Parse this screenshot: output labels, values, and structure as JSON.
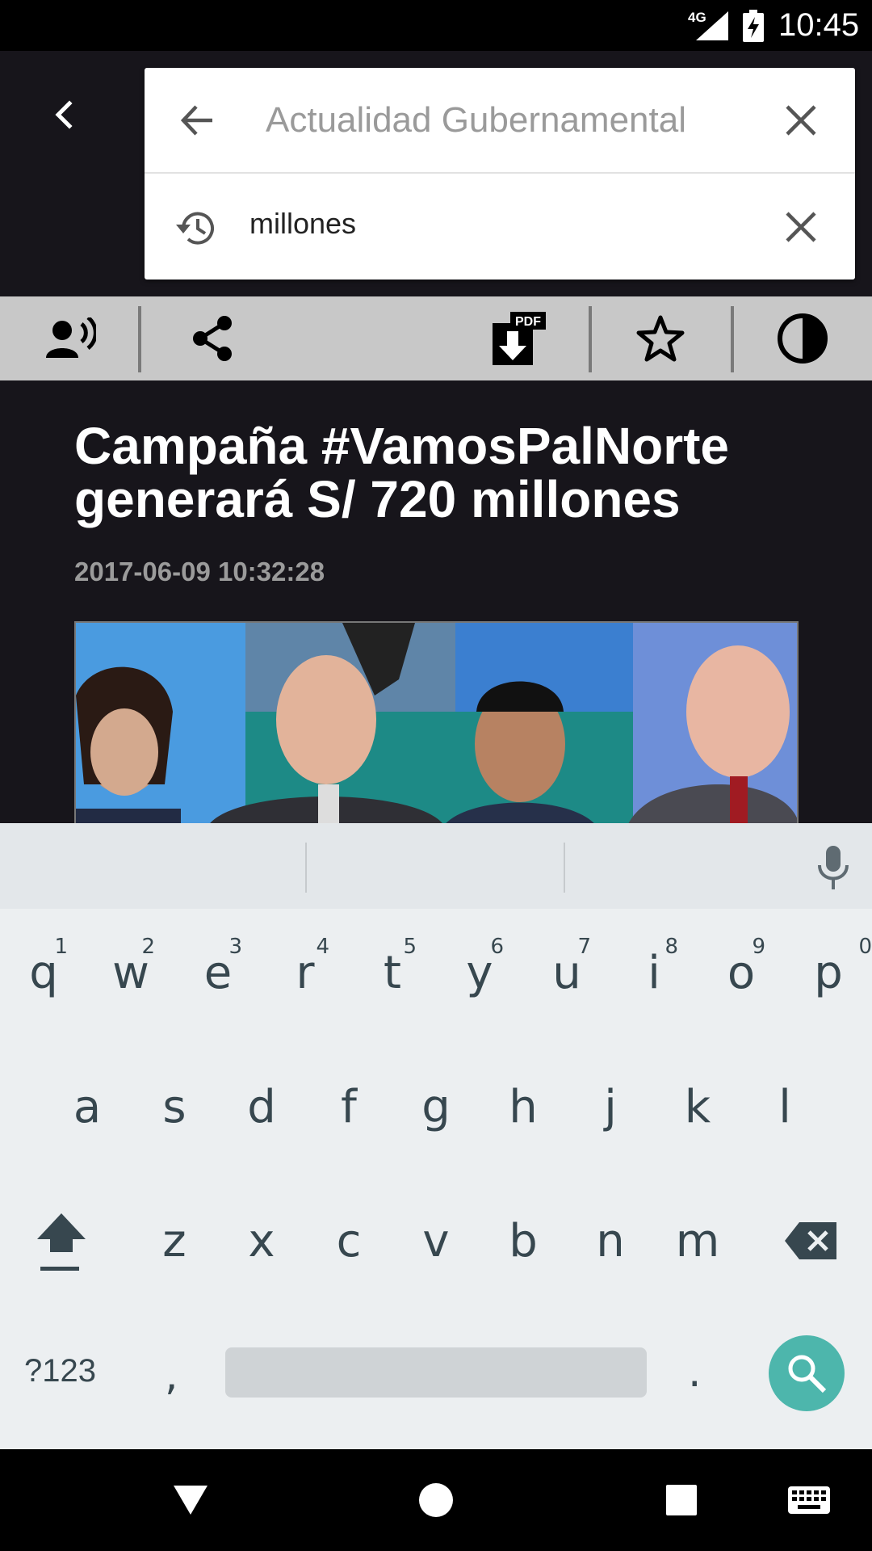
{
  "status_bar": {
    "network": "4G",
    "time": "10:45"
  },
  "search": {
    "placeholder": "Actualidad Gubernamental",
    "value": "",
    "suggestions": [
      {
        "text": "millones"
      }
    ]
  },
  "toolbar": {
    "items": [
      "voice-read",
      "share",
      "download-pdf",
      "favorite",
      "contrast"
    ],
    "pdf_badge": "PDF"
  },
  "article": {
    "title": "Campaña #VamosPalNorte generará S/ 720 millones",
    "date": "2017-06-09 10:32:28"
  },
  "keyboard": {
    "row1": [
      {
        "key": "q",
        "hint": "1"
      },
      {
        "key": "w",
        "hint": "2"
      },
      {
        "key": "e",
        "hint": "3"
      },
      {
        "key": "r",
        "hint": "4"
      },
      {
        "key": "t",
        "hint": "5"
      },
      {
        "key": "y",
        "hint": "6"
      },
      {
        "key": "u",
        "hint": "7"
      },
      {
        "key": "i",
        "hint": "8"
      },
      {
        "key": "o",
        "hint": "9"
      },
      {
        "key": "p",
        "hint": "0"
      }
    ],
    "row2": [
      "a",
      "s",
      "d",
      "f",
      "g",
      "h",
      "j",
      "k",
      "l"
    ],
    "row3": [
      "z",
      "x",
      "c",
      "v",
      "b",
      "n",
      "m"
    ],
    "symbols_label": "?123",
    "comma": ",",
    "period": ".",
    "accent_color": "#4db6ac"
  },
  "nav_bar": {
    "items": [
      "back",
      "home",
      "recents",
      "keyboard-switch"
    ]
  }
}
